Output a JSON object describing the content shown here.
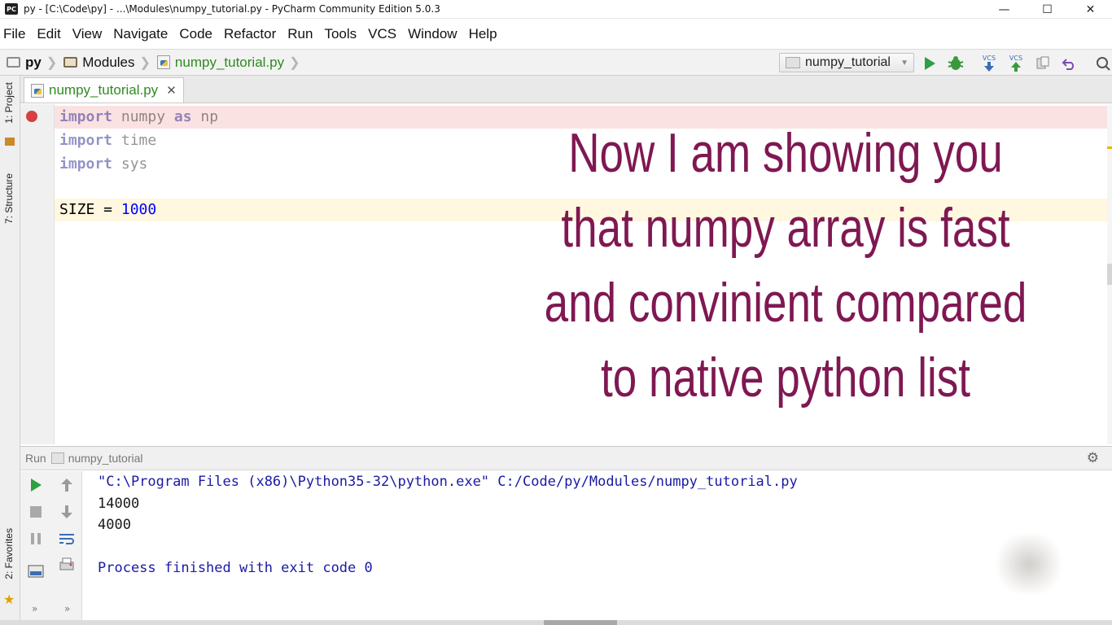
{
  "window": {
    "title": "py - [C:\\Code\\py] - ...\\Modules\\numpy_tutorial.py - PyCharm Community Edition 5.0.3",
    "icon_text": "PC",
    "controls": [
      "—",
      "☐",
      "✕"
    ]
  },
  "menu": [
    "File",
    "Edit",
    "View",
    "Navigate",
    "Code",
    "Refactor",
    "Run",
    "Tools",
    "VCS",
    "Window",
    "Help"
  ],
  "breadcrumb": {
    "project": "py",
    "folder": "Modules",
    "file": "numpy_tutorial.py"
  },
  "toolbar": {
    "run_config": "numpy_tutorial",
    "run_icon": "play-icon",
    "debug_icon": "bug-icon",
    "vcs_update_label": "VCS",
    "vcs_commit_label": "VCS",
    "accent_run": "#2ea043"
  },
  "left_strip": {
    "project": "1: Project",
    "structure": "7: Structure",
    "favorites": "2: Favorites"
  },
  "editor": {
    "tab_label": "numpy_tutorial.py",
    "tab_close": "✕",
    "lines": {
      "l1_kw": "import",
      "l1_mod": " numpy ",
      "l1_as": "as",
      "l1_alias": " np",
      "l2_kw": "import",
      "l2_mod": " time",
      "l3_kw": "import",
      "l3_mod": " sys",
      "l5_var": "SIZE = ",
      "l5_num": "1000"
    }
  },
  "overlay": {
    "text": "Now I am showing you that numpy array is fast and convinient compared to native python list",
    "color": "#7f1852"
  },
  "run_panel": {
    "label": "Run",
    "config": "numpy_tutorial",
    "output": {
      "command": "\"C:\\Program Files (x86)\\Python35-32\\python.exe\" C:/Code/py/Modules/numpy_tutorial.py",
      "line1": "14000",
      "line2": "4000",
      "finish": "Process finished with exit code 0"
    },
    "expand": "»"
  }
}
